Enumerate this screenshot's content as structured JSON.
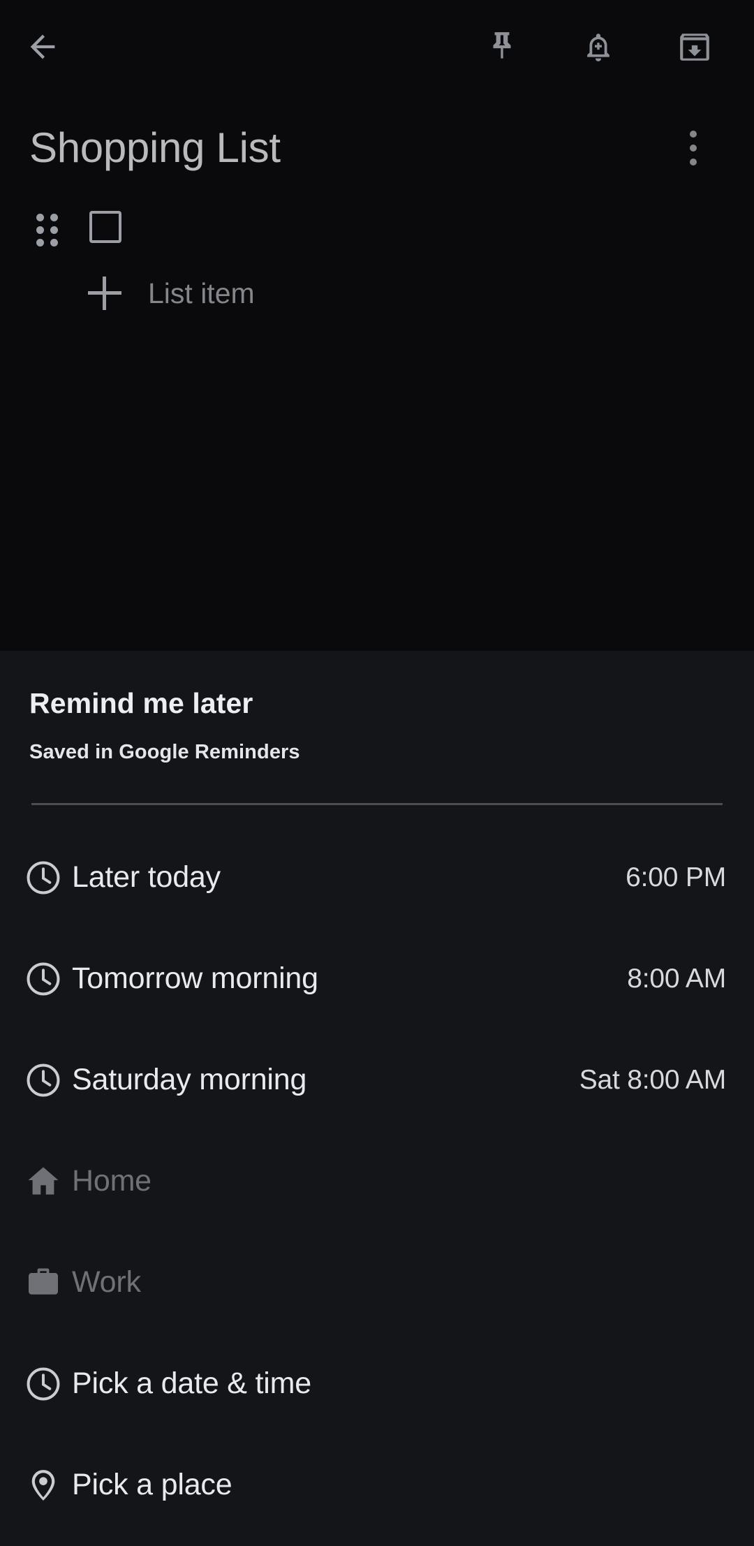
{
  "appbar": {
    "back_icon": "back-arrow-icon",
    "actions": [
      {
        "name": "pin-icon",
        "label": "Pin"
      },
      {
        "name": "add-reminder-icon",
        "label": "Remind me"
      },
      {
        "name": "archive-icon",
        "label": "Archive"
      }
    ]
  },
  "note": {
    "title": "Shopping List",
    "overflow_icon": "more-vert-icon",
    "checklist": [
      {
        "drag_handle": "drag-handle-icon",
        "checked": false,
        "text": ""
      }
    ],
    "add_item": {
      "icon": "plus-icon",
      "label": "List item"
    }
  },
  "sheet": {
    "title": "Remind me later",
    "subtitle": "Saved in Google Reminders",
    "options": [
      {
        "icon": "clock-icon",
        "label": "Later today",
        "time": "6:00 PM",
        "disabled": false
      },
      {
        "icon": "clock-icon",
        "label": "Tomorrow morning",
        "time": "8:00 AM",
        "disabled": false
      },
      {
        "icon": "clock-icon",
        "label": "Saturday morning",
        "time": "Sat 8:00 AM",
        "disabled": false
      },
      {
        "icon": "home-icon",
        "label": "Home",
        "time": "",
        "disabled": true
      },
      {
        "icon": "work-icon",
        "label": "Work",
        "time": "",
        "disabled": true
      },
      {
        "icon": "clock-icon",
        "label": "Pick a date & time",
        "time": "",
        "disabled": false
      },
      {
        "icon": "location-icon",
        "label": "Pick a place",
        "time": "",
        "disabled": false
      }
    ]
  },
  "colors": {
    "note_bg": "#0a0a0c",
    "sheet_bg": "#141519",
    "primary_text": "#e8eaed",
    "secondary_text": "#9ca0a6",
    "disabled_text": "#6f7176"
  }
}
